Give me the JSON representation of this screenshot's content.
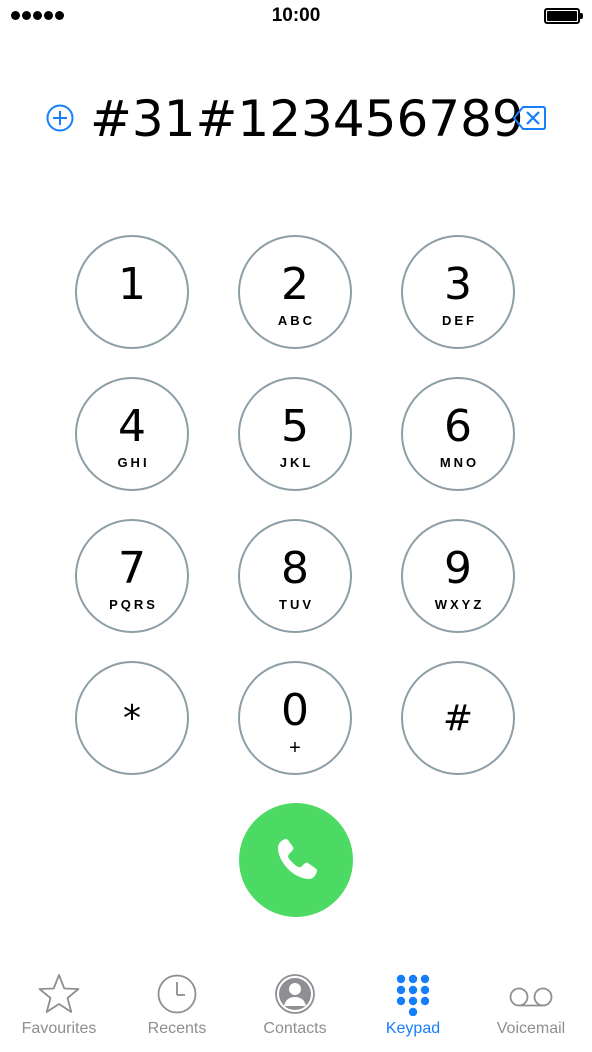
{
  "status_bar": {
    "time": "10:00",
    "signal_icon": "signal-dots-icon",
    "battery_icon": "battery-full-icon"
  },
  "dialer": {
    "number": "#31#123456789",
    "add_contact_icon": "add-circle-icon",
    "delete_icon": "backspace-icon",
    "accent_color": "#157efb"
  },
  "keypad": {
    "keys": [
      {
        "digit": "1",
        "letters": ""
      },
      {
        "digit": "2",
        "letters": "ABC"
      },
      {
        "digit": "3",
        "letters": "DEF"
      },
      {
        "digit": "4",
        "letters": "GHI"
      },
      {
        "digit": "5",
        "letters": "JKL"
      },
      {
        "digit": "6",
        "letters": "MNO"
      },
      {
        "digit": "7",
        "letters": "PQRS"
      },
      {
        "digit": "8",
        "letters": "TUV"
      },
      {
        "digit": "9",
        "letters": "WXYZ"
      },
      {
        "digit": "*",
        "letters": ""
      },
      {
        "digit": "0",
        "letters": "+"
      },
      {
        "digit": "#",
        "letters": ""
      }
    ],
    "key_border_color": "#8e9ea6",
    "call_button_color": "#4cd964",
    "call_icon": "phone-icon"
  },
  "tab_bar": {
    "tabs": [
      {
        "label": "Favourites",
        "icon": "star-icon",
        "active": false
      },
      {
        "label": "Recents",
        "icon": "clock-icon",
        "active": false
      },
      {
        "label": "Contacts",
        "icon": "contact-icon",
        "active": false
      },
      {
        "label": "Keypad",
        "icon": "keypad-grid-icon",
        "active": true
      },
      {
        "label": "Voicemail",
        "icon": "voicemail-icon",
        "active": false
      }
    ],
    "active_color": "#157efb",
    "inactive_color": "#8e8e93"
  }
}
